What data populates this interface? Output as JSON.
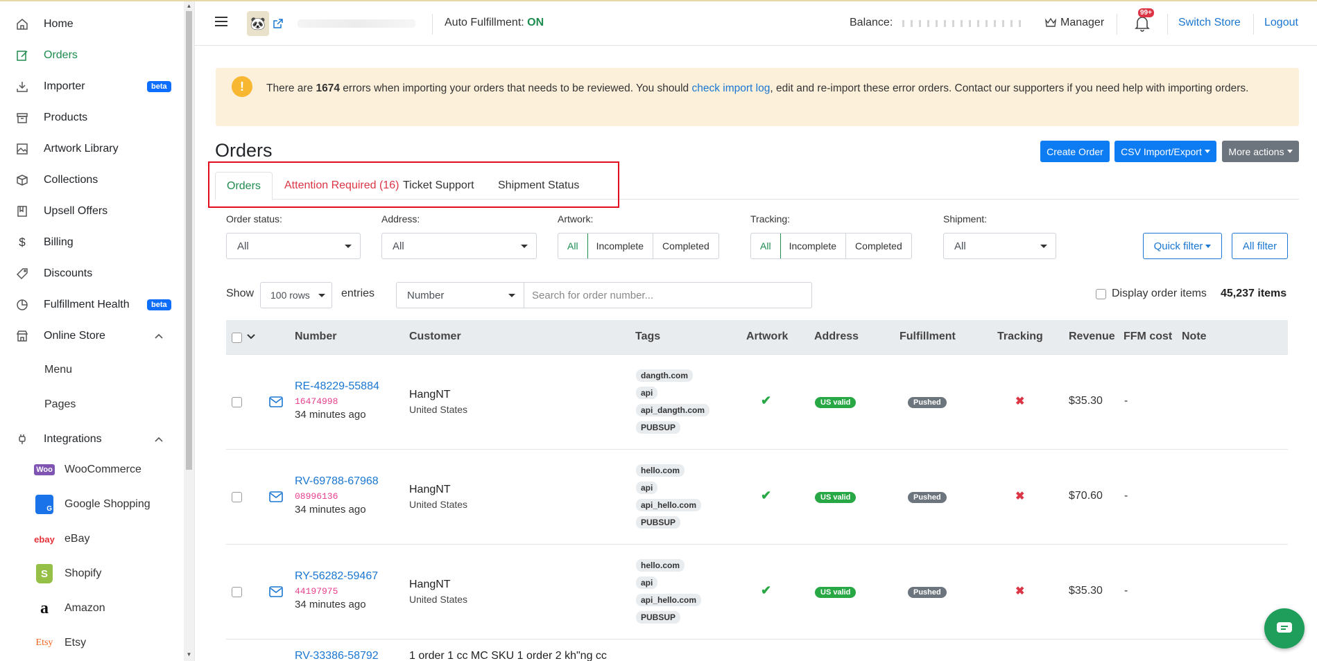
{
  "sidebar": {
    "items": [
      {
        "label": "Home",
        "icon": "home-icon"
      },
      {
        "label": "Orders",
        "icon": "edit-icon"
      },
      {
        "label": "Importer",
        "icon": "download-icon",
        "badge": "beta"
      },
      {
        "label": "Products",
        "icon": "box-icon"
      },
      {
        "label": "Artwork Library",
        "icon": "image-icon"
      },
      {
        "label": "Collections",
        "icon": "cube-icon"
      },
      {
        "label": "Upsell Offers",
        "icon": "book-icon"
      },
      {
        "label": "Billing",
        "icon": "dollar-icon"
      },
      {
        "label": "Discounts",
        "icon": "tag-icon"
      },
      {
        "label": "Fulfillment Health",
        "icon": "pie-chart-icon",
        "badge": "beta"
      },
      {
        "label": "Online Store",
        "icon": "store-icon"
      },
      {
        "label": "Integrations",
        "icon": "plug-icon"
      }
    ],
    "online_store_sub": [
      "Menu",
      "Pages"
    ],
    "integrations": [
      {
        "label": "WooCommerce",
        "logo": "Woo"
      },
      {
        "label": "Google Shopping",
        "logo": "G"
      },
      {
        "label": "eBay",
        "logo": "ebay"
      },
      {
        "label": "Shopify",
        "logo": "S"
      },
      {
        "label": "Amazon",
        "logo": "a"
      },
      {
        "label": "Etsy",
        "logo": "Etsy"
      }
    ]
  },
  "topbar": {
    "auto_fulfillment_label": "Auto Fulfillment:",
    "auto_fulfillment_value": "ON",
    "balance_label": "Balance:",
    "manager_label": "Manager",
    "notification_count": "99+",
    "switch_store": "Switch Store",
    "logout": "Logout"
  },
  "alert": {
    "pre": "There are ",
    "count": "1674",
    "mid": " errors when importing your orders that needs to be reviewed. You should ",
    "link": "check import log",
    "post": ", edit and re-import these error orders. Contact our supporters if you need help with importing orders."
  },
  "page": {
    "title": "Orders",
    "create_order": "Create Order",
    "csv": "CSV Import/Export",
    "more_actions": "More actions"
  },
  "tabs": [
    "Orders",
    "Attention Required (16)",
    "Ticket Support",
    "Shipment Status"
  ],
  "filters": {
    "order_status_label": "Order status:",
    "order_status_value": "All",
    "address_label": "Address:",
    "address_value": "All",
    "artwork_label": "Artwork:",
    "artwork_options": [
      "All",
      "Incomplete",
      "Completed"
    ],
    "tracking_label": "Tracking:",
    "tracking_options": [
      "All",
      "Incomplete",
      "Completed"
    ],
    "shipment_label": "Shipment:",
    "shipment_value": "All",
    "quick_filter": "Quick filter",
    "all_filter": "All filter"
  },
  "list_controls": {
    "show": "Show",
    "rows": "100 rows",
    "entries": "entries",
    "search_field": "Number",
    "search_placeholder": "Search for order number...",
    "display_items": "Display order items",
    "items_count": "45,237 items"
  },
  "table": {
    "headers": [
      "Number",
      "Customer",
      "Tags",
      "Artwork",
      "Address",
      "Fulfillment",
      "Tracking",
      "Revenue",
      "FFM cost",
      "Note"
    ],
    "rows": [
      {
        "number": "RE-48229-55884",
        "code": "16474998",
        "time": "34 minutes ago",
        "customer": "HangNT",
        "country": "United States",
        "tags": [
          "dangth.com",
          "api",
          "api_dangth.com",
          "PUBSUP"
        ],
        "address": "US valid",
        "fulfillment": "Pushed",
        "revenue": "$35.30",
        "note": "-"
      },
      {
        "number": "RV-69788-67968",
        "code": "08996136",
        "time": "34 minutes ago",
        "customer": "HangNT",
        "country": "United States",
        "tags": [
          "hello.com",
          "api",
          "api_hello.com",
          "PUBSUP"
        ],
        "address": "US valid",
        "fulfillment": "Pushed",
        "revenue": "$70.60",
        "note": "-"
      },
      {
        "number": "RY-56282-59467",
        "code": "44197975",
        "time": "34 minutes ago",
        "customer": "HangNT",
        "country": "United States",
        "tags": [
          "hello.com",
          "api",
          "api_hello.com",
          "PUBSUP"
        ],
        "address": "US valid",
        "fulfillment": "Pushed",
        "revenue": "$35.30",
        "note": "-"
      },
      {
        "number": "RV-33386-58792",
        "customer": "1 order 1 cc MC SKU 1 order 2 kh\"ng cc"
      }
    ]
  },
  "colors": {
    "primary": "#0d7cf2",
    "success": "#1e8c4e",
    "danger": "#dc3545",
    "alert_bg": "#fdf0db"
  }
}
